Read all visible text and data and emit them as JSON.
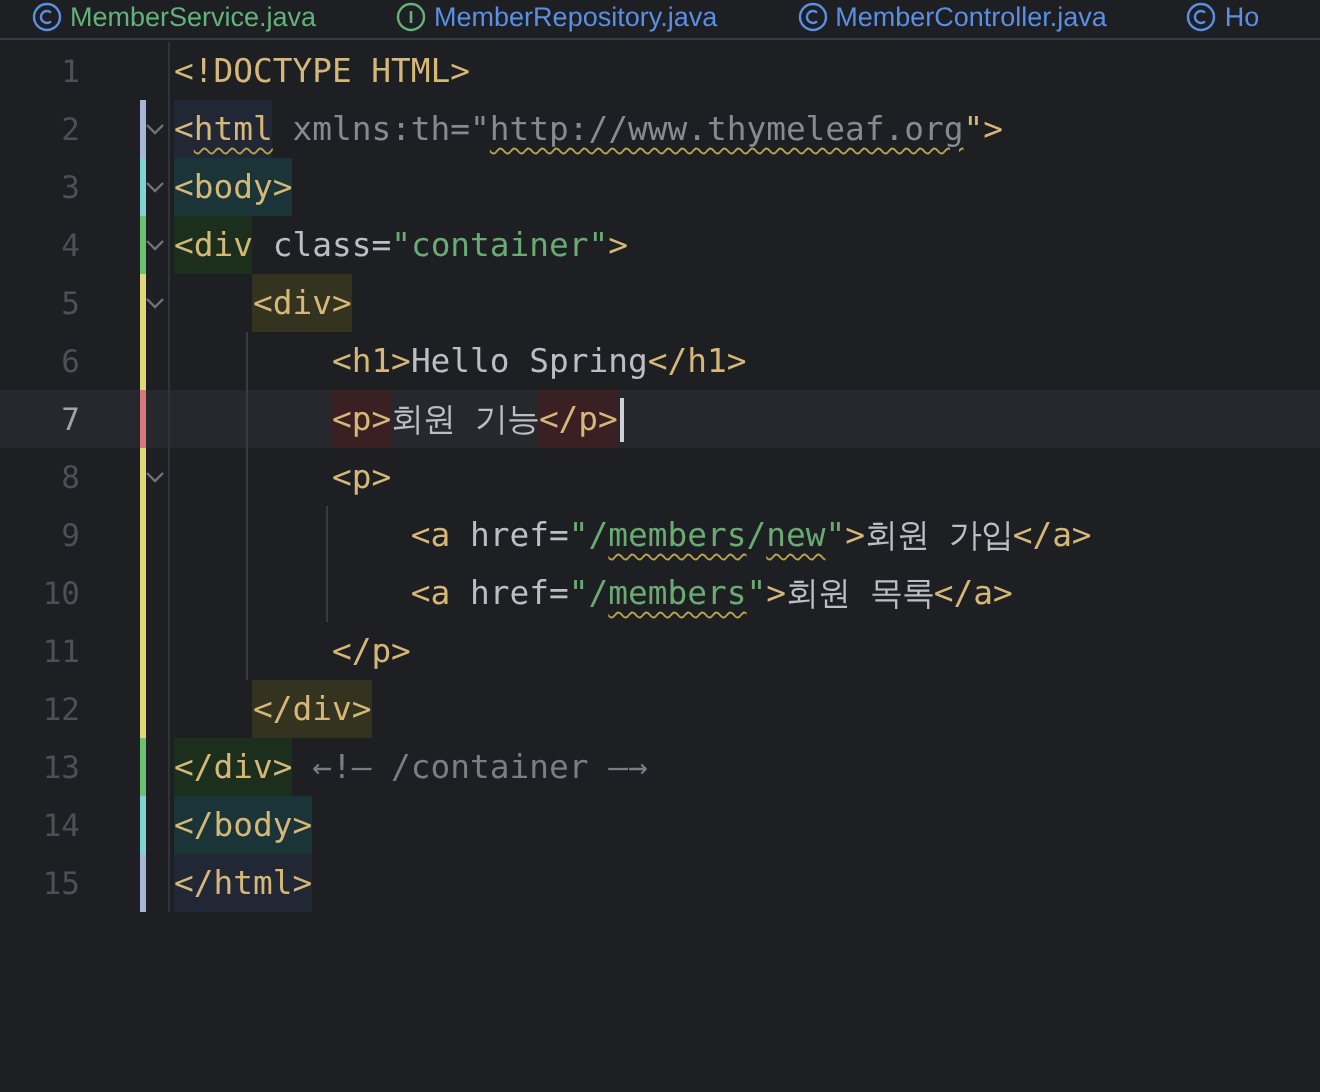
{
  "tabs": [
    {
      "label": "MemberService.java",
      "kind": "new-class"
    },
    {
      "label": "MemberRepository.java",
      "kind": "interface"
    },
    {
      "label": "MemberController.java",
      "kind": "class"
    },
    {
      "label": "Ho",
      "kind": "class"
    }
  ],
  "lines": [
    {
      "number": "1",
      "foldable": false,
      "selected": false,
      "tokens": [
        {
          "text": "<!DOCTYPE HTML>",
          "kind": "tag"
        }
      ]
    },
    {
      "number": "2",
      "foldable": true,
      "selected": false,
      "color": "#a7b5d6",
      "tokens": [
        {
          "text": "<",
          "kind": "tag",
          "color": "#212734"
        },
        {
          "text": "html",
          "kind": "tag",
          "color": "#212734",
          "warn": true
        },
        {
          "text": " xmlns:th=\"",
          "kind": "ns"
        },
        {
          "text": "http://www.thymeleaf.org",
          "kind": "ns",
          "warn": true
        },
        {
          "text": "\">",
          "kind": "tag"
        }
      ]
    },
    {
      "number": "3",
      "foldable": true,
      "selected": false,
      "color": "#7fd3d8",
      "tokens": [
        {
          "text": "<body>",
          "kind": "tag",
          "color": "#1b3438"
        }
      ]
    },
    {
      "number": "4",
      "foldable": true,
      "selected": false,
      "color": "#6cc070",
      "tokens": [
        {
          "text": "<div",
          "kind": "tag",
          "color": "#1c2f1d"
        },
        {
          "text": " class",
          "kind": "attr"
        },
        {
          "text": "=",
          "kind": "attr"
        },
        {
          "text": "\"container\"",
          "kind": "str"
        },
        {
          "text": ">",
          "kind": "tag"
        }
      ]
    },
    {
      "number": "5",
      "foldable": true,
      "selected": false,
      "color": "#e0d87a",
      "tokens": [
        {
          "text": "    <div>",
          "kind": "tag",
          "color": "#33331f"
        }
      ]
    },
    {
      "number": "6",
      "foldable": false,
      "selected": false,
      "color": "#e0d87a",
      "tokens": [
        {
          "text": "        <h1>",
          "kind": "tag"
        },
        {
          "text": "Hello Spring",
          "kind": "text"
        },
        {
          "text": "</h1>",
          "kind": "tag"
        }
      ]
    },
    {
      "number": "7",
      "foldable": false,
      "selected": true,
      "color": "#d9777a",
      "tokens": [
        {
          "text": "        <p>",
          "kind": "tag",
          "color": "#3a2023"
        },
        {
          "text": "회원 기능",
          "kind": "text"
        },
        {
          "text": "</p>",
          "kind": "tag",
          "color": "#3a2023"
        }
      ]
    },
    {
      "number": "8",
      "foldable": true,
      "selected": false,
      "color": "#e0d87a",
      "tokens": [
        {
          "text": "        <p>",
          "kind": "tag"
        }
      ]
    },
    {
      "number": "9",
      "foldable": false,
      "selected": false,
      "color": "#e0d87a",
      "tokens": [
        {
          "text": "            <a",
          "kind": "tag"
        },
        {
          "text": " href",
          "kind": "attr"
        },
        {
          "text": "=",
          "kind": "attr"
        },
        {
          "text": "\"/",
          "kind": "str"
        },
        {
          "text": "members",
          "kind": "str",
          "warn": true
        },
        {
          "text": "/",
          "kind": "str"
        },
        {
          "text": "new",
          "kind": "str",
          "warn": true
        },
        {
          "text": "\"",
          "kind": "str"
        },
        {
          "text": ">",
          "kind": "tag"
        },
        {
          "text": "회원 가입",
          "kind": "text"
        },
        {
          "text": "</a>",
          "kind": "tag"
        }
      ]
    },
    {
      "number": "10",
      "foldable": false,
      "selected": false,
      "color": "#e0d87a",
      "tokens": [
        {
          "text": "            <a",
          "kind": "tag"
        },
        {
          "text": " href",
          "kind": "attr"
        },
        {
          "text": "=",
          "kind": "attr"
        },
        {
          "text": "\"/",
          "kind": "str"
        },
        {
          "text": "members",
          "kind": "str",
          "warn": true
        },
        {
          "text": "\"",
          "kind": "str"
        },
        {
          "text": ">",
          "kind": "tag"
        },
        {
          "text": "회원 목록",
          "kind": "text"
        },
        {
          "text": "</a>",
          "kind": "tag"
        }
      ]
    },
    {
      "number": "11",
      "foldable": false,
      "selected": false,
      "color": "#e0d87a",
      "tokens": [
        {
          "text": "        </p>",
          "kind": "tag"
        }
      ]
    },
    {
      "number": "12",
      "foldable": false,
      "selected": false,
      "color": "#e0d87a",
      "tokens": [
        {
          "text": "    </div>",
          "kind": "tag",
          "color": "#33331f"
        }
      ]
    },
    {
      "number": "13",
      "foldable": false,
      "selected": false,
      "color": "#6cc070",
      "tokens": [
        {
          "text": "</div>",
          "kind": "tag",
          "color": "#1c2f1d"
        },
        {
          "text": " ←!— /container —→",
          "kind": "comment"
        }
      ]
    },
    {
      "number": "14",
      "foldable": false,
      "selected": false,
      "color": "#7fd3d8",
      "tokens": [
        {
          "text": "</body>",
          "kind": "tag",
          "color": "#1b3438"
        }
      ]
    },
    {
      "number": "15",
      "foldable": false,
      "selected": false,
      "color": "#a7b5d6",
      "tokens": [
        {
          "text": "</html>",
          "kind": "tag",
          "color": "#212734"
        }
      ]
    }
  ]
}
